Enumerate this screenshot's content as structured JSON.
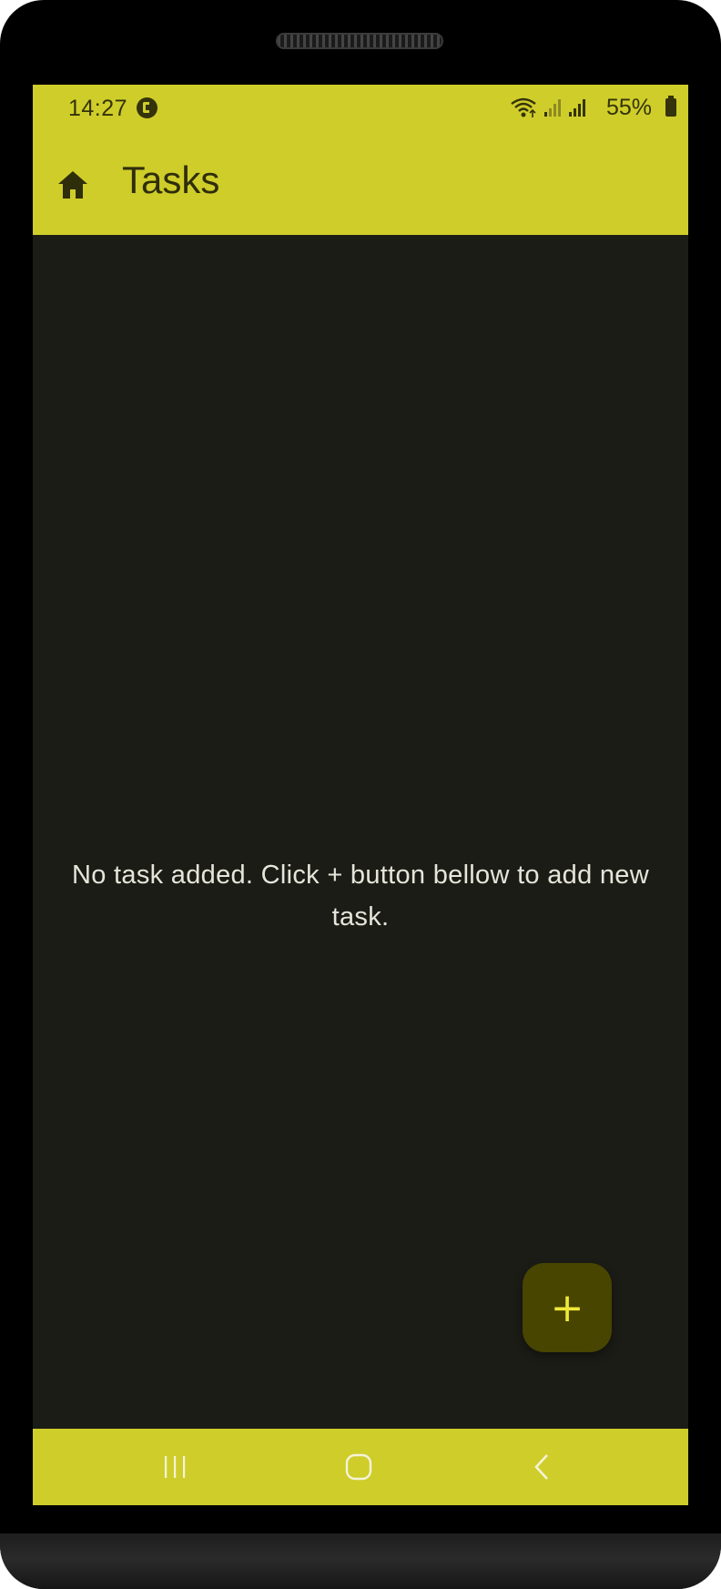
{
  "status_bar": {
    "time": "14:27",
    "battery": "55%",
    "icons": [
      "app-notification-icon",
      "wifi-icon",
      "signal-icon",
      "signal-icon",
      "battery-icon"
    ]
  },
  "app_bar": {
    "title": "Tasks",
    "nav_icon": "home-icon"
  },
  "main": {
    "empty_message": "No task added. Click + button bellow to add new task."
  },
  "fab": {
    "label": "+",
    "icon": "plus-icon"
  },
  "nav_bar": {
    "buttons": [
      "recent-apps-icon",
      "home-circle-icon",
      "back-icon"
    ]
  },
  "colors": {
    "accent": "#cfcd2a",
    "background": "#1c1c17",
    "fab": "#474500",
    "fab_icon": "#efe83a",
    "on_accent": "#34330a",
    "body_text": "#e6e5da"
  }
}
